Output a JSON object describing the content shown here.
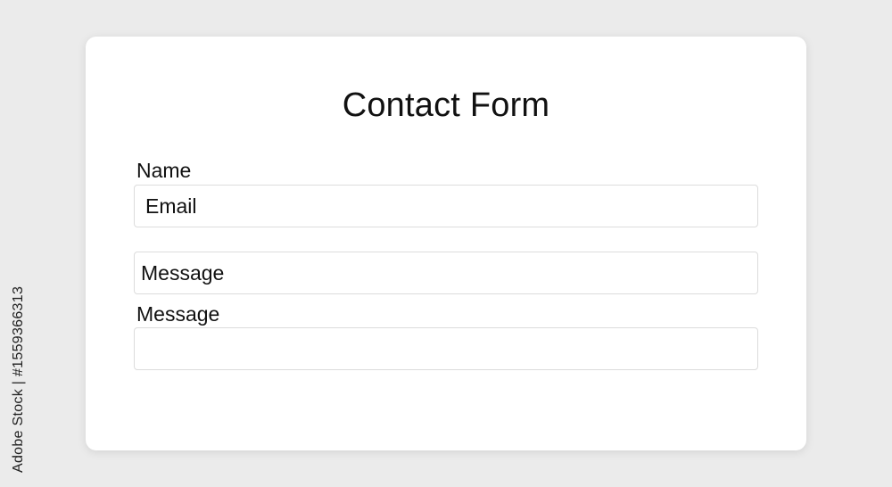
{
  "form": {
    "title": "Contact Form",
    "fields": [
      {
        "label": "Name",
        "placeholder": "Email",
        "value": ""
      },
      {
        "label": "",
        "placeholder": "Message",
        "value": ""
      },
      {
        "label": "Message",
        "placeholder": "",
        "value": ""
      }
    ]
  },
  "stock_watermark": {
    "text": "Adobe Stock | #1559366313"
  },
  "colors": {
    "page_background": "#ebebeb",
    "card_background": "#ffffff",
    "field_border": "#dcdcdc",
    "text": "#111111"
  }
}
